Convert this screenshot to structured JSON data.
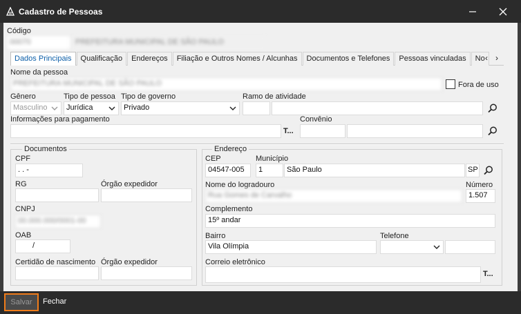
{
  "window": {
    "title": "Cadastro de Pessoas"
  },
  "codigo": {
    "label": "Código",
    "value": "00070",
    "name_value": "PREFEITURA MUNICIPAL DE SÃO PAULO"
  },
  "tabs": [
    {
      "label": "Dados Principais",
      "active": true
    },
    {
      "label": "Qualificação"
    },
    {
      "label": "Endereços"
    },
    {
      "label": "Filiação e Outros Nomes / Alcunhas"
    },
    {
      "label": "Documentos e Telefones"
    },
    {
      "label": "Pessoas vinculadas"
    },
    {
      "label": "No"
    }
  ],
  "tab_scroll": {
    "left": "‹",
    "right": "›"
  },
  "pessoa": {
    "nome_label": "Nome da pessoa",
    "nome_value": "PREFEITURA MUNICIPAL DE SÃO PAULO",
    "fora_uso_label": "Fora de uso",
    "genero_label": "Gênero",
    "genero_value": "Masculino",
    "tipo_pessoa_label": "Tipo de pessoa",
    "tipo_pessoa_value": "Jurídica",
    "tipo_governo_label": "Tipo de governo",
    "tipo_governo_value": "Privado",
    "ramo_label": "Ramo de atividade",
    "info_pag_label": "Informações para pagamento",
    "info_pag_more": "T...",
    "convenio_label": "Convênio"
  },
  "documentos": {
    "title": "Documentos",
    "cpf_label": "CPF",
    "cpf_value": "  .   .   -",
    "rg_label": "RG",
    "orgao_label": "Órgão expedidor",
    "cnpj_label": "CNPJ",
    "cnpj_value": "00.000.000/0001-00",
    "oab_label": "OAB",
    "oab_value": "/",
    "certidao_label": "Certidão de nascimento",
    "orgao2_label": "Órgão expedidor"
  },
  "endereco": {
    "title": "Endereço",
    "cep_label": "CEP",
    "cep_value": "04547-005",
    "municipio_label": "Município",
    "municipio_code": "1",
    "municipio_value": "São Paulo",
    "uf_value": "SP",
    "logradouro_label": "Nome do logradouro",
    "logradouro_value": "Rua Gomes de Carvalho",
    "numero_label": "Número",
    "numero_value": "1.507",
    "complemento_label": "Complemento",
    "complemento_value": "15º andar",
    "bairro_label": "Bairro",
    "bairro_value": "Vila Olímpia",
    "telefone_label": "Telefone",
    "email_label": "Correio eletrônico",
    "email_more": "T..."
  },
  "footer": {
    "save_label": "Salvar",
    "close_label": "Fechar"
  },
  "colors": {
    "accent": "#f07c1a",
    "titlebar": "#2b2b2b",
    "tab_active": "#0b5ea8"
  },
  "icons": [
    "app-icon",
    "minimize-icon",
    "close-icon",
    "search-icon",
    "chevron-down-icon"
  ]
}
